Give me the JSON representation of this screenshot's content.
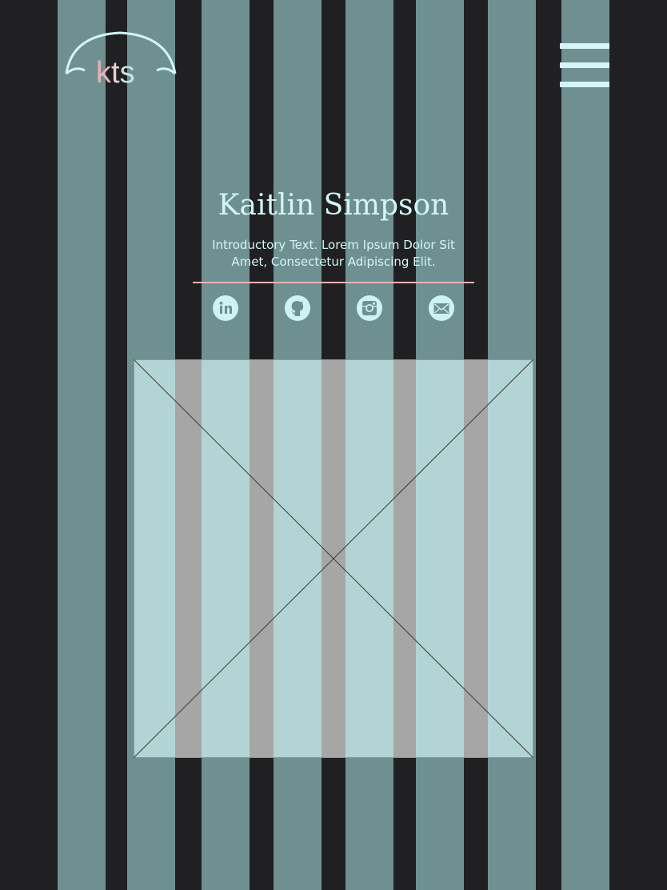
{
  "brand": {
    "logo_k": "k",
    "logo_t": "t",
    "logo_s": "s",
    "logo_icon": "umbrella-arc"
  },
  "nav": {
    "menu_icon": "hamburger-icon"
  },
  "hero": {
    "name": "Kaitlin Simpson",
    "intro_line1": "Introductory Text. Lorem Ipsum Dolor Sit",
    "intro_line2": "Amet, Consectetur Adipiscing Elit."
  },
  "social": [
    {
      "icon": "linkedin-icon"
    },
    {
      "icon": "github-icon"
    },
    {
      "icon": "instagram-icon"
    },
    {
      "icon": "email-icon"
    }
  ],
  "colors": {
    "background": "#202022",
    "column": "#6f9091",
    "accent_light": "#d3f5f7",
    "accent_pink": "#e8b4b6",
    "image_placeholder": "#b3d4d4"
  }
}
